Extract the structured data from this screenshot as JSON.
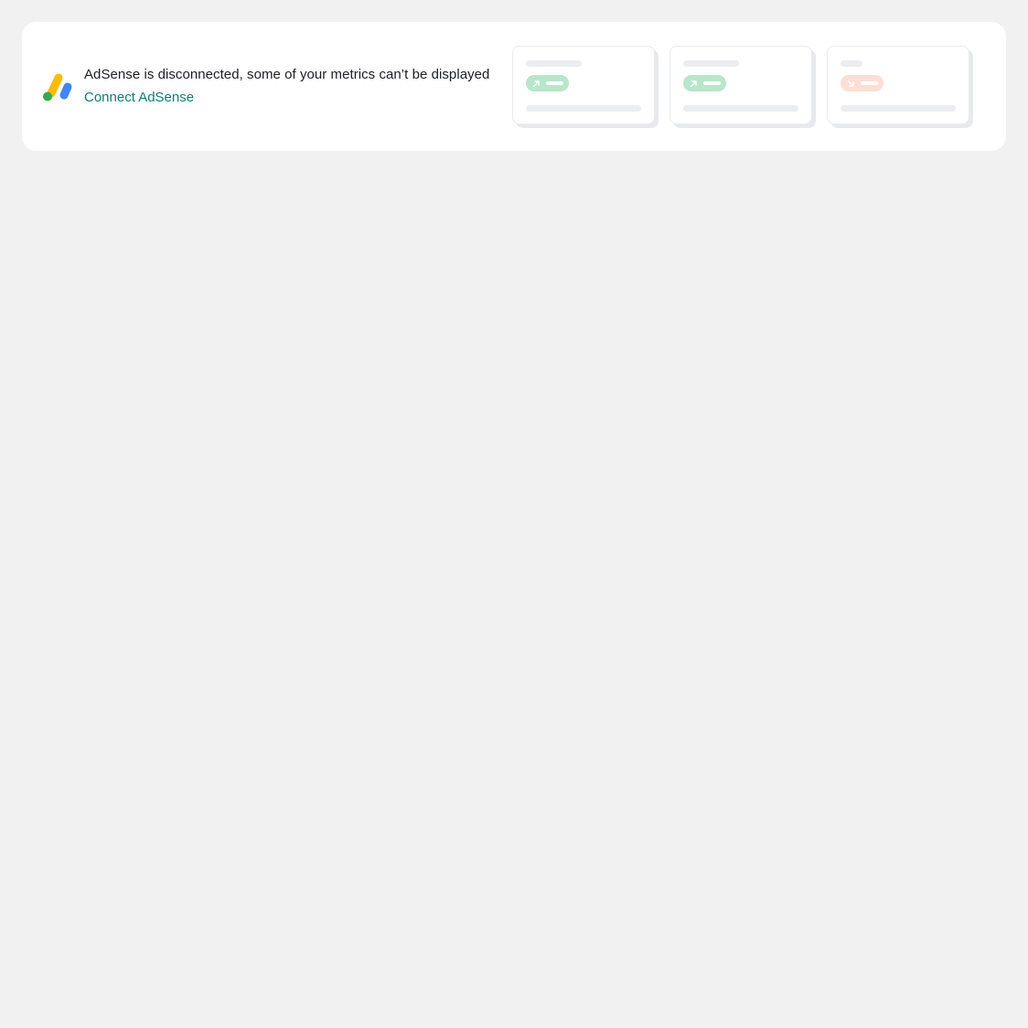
{
  "banner": {
    "message": "AdSense is disconnected, some of your metrics can’t be displayed",
    "connect_label": "Connect AdSense",
    "link_color": "#137c79"
  },
  "logo": {
    "icon": "adsense-logo-icon",
    "colors": [
      "#fbbc04",
      "#34a853",
      "#4285f4"
    ]
  },
  "preview_cards": [
    {
      "trend": "up",
      "icon": "arrow-up-right-icon",
      "color": "#b8e6ca"
    },
    {
      "trend": "up",
      "icon": "arrow-up-right-icon",
      "color": "#b8e6ca"
    },
    {
      "trend": "down",
      "icon": "arrow-down-right-icon",
      "color": "#ffded3"
    }
  ]
}
